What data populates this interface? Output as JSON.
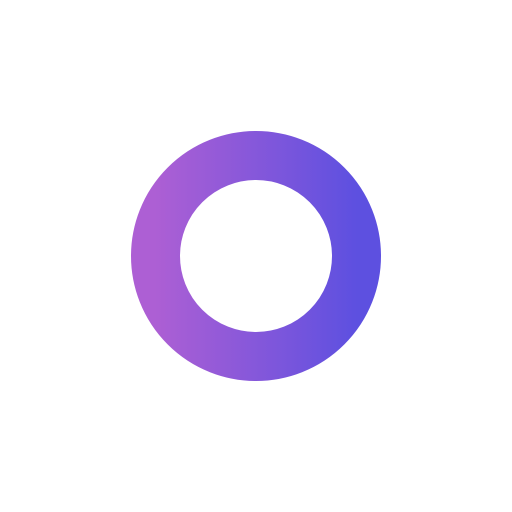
{
  "background_color": "#ffffff",
  "ring": {
    "icon": "ring-icon",
    "gradient_start_color": "#ad5fd4",
    "gradient_end_color": "#5d50e0"
  }
}
